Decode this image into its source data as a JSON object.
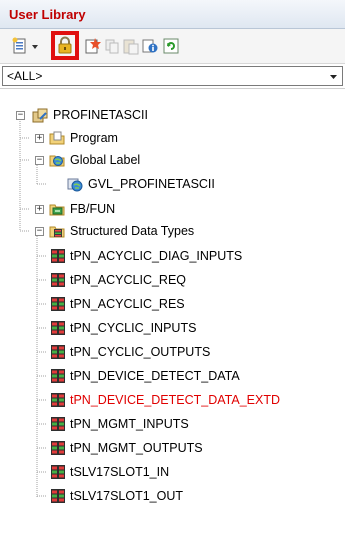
{
  "panel": {
    "title": "User Library"
  },
  "toolbar": {
    "icons": [
      "new-item-icon",
      "dropdown-arrow-icon",
      "lock-icon",
      "new-folder-icon",
      "copy-icon",
      "paste-icon",
      "properties-icon",
      "refresh-icon"
    ]
  },
  "filter": {
    "value": "<ALL>"
  },
  "tree": {
    "root": {
      "label": "PROFINETASCII"
    },
    "program": {
      "label": "Program"
    },
    "global_label": {
      "label": "Global Label"
    },
    "gvl": {
      "label": "GVL_PROFINETASCII"
    },
    "fbfun": {
      "label": "FB/FUN"
    },
    "sdt": {
      "label": "Structured Data Types"
    },
    "types": [
      {
        "label": "tPN_ACYCLIC_DIAG_INPUTS"
      },
      {
        "label": "tPN_ACYCLIC_REQ"
      },
      {
        "label": "tPN_ACYCLIC_RES"
      },
      {
        "label": "tPN_CYCLIC_INPUTS"
      },
      {
        "label": "tPN_CYCLIC_OUTPUTS"
      },
      {
        "label": "tPN_DEVICE_DETECT_DATA"
      },
      {
        "label": "tPN_DEVICE_DETECT_DATA_EXTD"
      },
      {
        "label": "tPN_MGMT_INPUTS"
      },
      {
        "label": "tPN_MGMT_OUTPUTS"
      },
      {
        "label": "tSLV17SLOT1_IN"
      },
      {
        "label": "tSLV17SLOT1_OUT"
      }
    ]
  },
  "colors": {
    "title": "#c00000",
    "highlight_box": "#e01010",
    "selected_text": "#e00000"
  }
}
